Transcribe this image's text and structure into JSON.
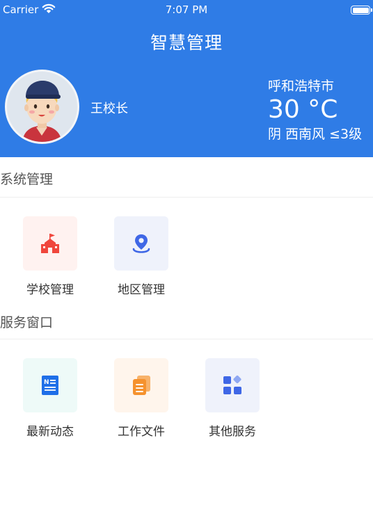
{
  "status_bar": {
    "carrier": "Carrier",
    "time": "7:07 PM"
  },
  "app": {
    "title": "智慧管理"
  },
  "user": {
    "name": "王校长"
  },
  "weather": {
    "city": "呼和浩特市",
    "temperature": "30 °C",
    "condition": "阴 西南风 ≤3级"
  },
  "sections": {
    "system": {
      "title": "系统管理",
      "items": [
        {
          "label": "学校管理",
          "icon": "school-icon",
          "bg": "#fff2f0",
          "color": "#f0463c"
        },
        {
          "label": "地区管理",
          "icon": "location-pin-icon",
          "bg": "#eff2fb",
          "color": "#3f67e6"
        }
      ]
    },
    "service": {
      "title": "服务窗口",
      "items": [
        {
          "label": "最新动态",
          "icon": "news-icon",
          "bg": "#eefaf8",
          "color": "#1f6fe8"
        },
        {
          "label": "工作文件",
          "icon": "documents-icon",
          "bg": "#fff5ec",
          "color": "#f5922e"
        },
        {
          "label": "其他服务",
          "icon": "apps-icon",
          "bg": "#eff2fb",
          "color": "#3f67e6"
        }
      ]
    }
  }
}
